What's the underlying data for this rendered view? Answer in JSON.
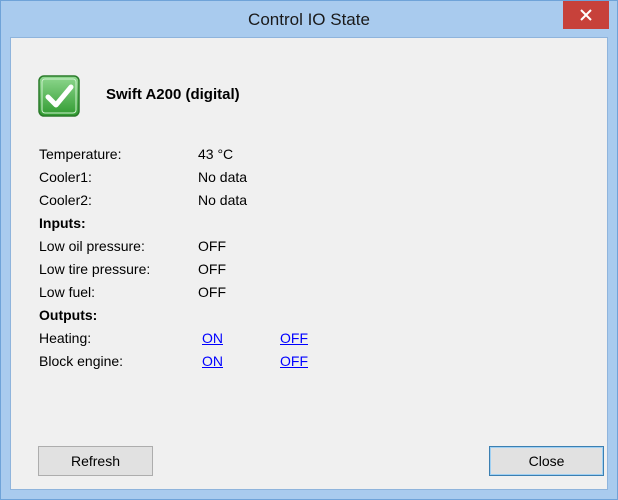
{
  "window": {
    "title": "Control IO State"
  },
  "device": {
    "name": "Swift A200 (digital)",
    "status_icon": "green-checkmark-icon"
  },
  "sensors": [
    {
      "label": "Temperature:",
      "value": "43 °C"
    },
    {
      "label": "Cooler1:",
      "value": "No data"
    },
    {
      "label": "Cooler2:",
      "value": "No data"
    }
  ],
  "inputs": {
    "heading": "Inputs:",
    "items": [
      {
        "label": "Low oil pressure:",
        "value": "OFF"
      },
      {
        "label": "Low tire pressure:",
        "value": "OFF"
      },
      {
        "label": "Low fuel:",
        "value": "OFF"
      }
    ]
  },
  "outputs": {
    "heading": "Outputs:",
    "items": [
      {
        "label": "Heating:",
        "on_label": "ON",
        "off_label": "OFF"
      },
      {
        "label": "Block engine:",
        "on_label": "ON",
        "off_label": "OFF"
      }
    ]
  },
  "buttons": {
    "refresh_label": "Refresh",
    "close_label": "Close"
  },
  "colors": {
    "titlebar": "#a9cbee",
    "close_button": "#c7413a",
    "link": "#0000ff",
    "dialog_background": "#f0f0f0",
    "check_green": "#3aa53a"
  }
}
